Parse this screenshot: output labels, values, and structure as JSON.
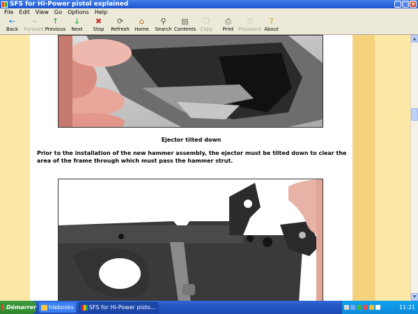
{
  "window": {
    "title": "SFS for Hi-Power pistol explained",
    "min": "_",
    "max": "□",
    "close": "x"
  },
  "menu": [
    "File",
    "Edit",
    "View",
    "Go",
    "Options",
    "Help"
  ],
  "toolbar": [
    {
      "label": "Back",
      "icon": "←",
      "color": "#1a8ad4",
      "enabled": true,
      "name": "back"
    },
    {
      "label": "Forward",
      "icon": "→",
      "color": "#888888",
      "enabled": false,
      "name": "forward"
    },
    {
      "label": "Previous",
      "icon": "↑",
      "color": "#21a121",
      "enabled": true,
      "name": "previous"
    },
    {
      "label": "Next",
      "icon": "↓",
      "color": "#21a121",
      "enabled": true,
      "name": "next"
    },
    {
      "label": "Stop",
      "icon": "✖",
      "color": "#d22a1e",
      "enabled": true,
      "name": "stop"
    },
    {
      "label": "Refresh",
      "icon": "⟳",
      "color": "#555555",
      "enabled": true,
      "name": "refresh"
    },
    {
      "label": "Home",
      "icon": "⌂",
      "color": "#b06a2a",
      "enabled": true,
      "name": "home"
    },
    {
      "label": "Search",
      "icon": "⚲",
      "color": "#444444",
      "enabled": true,
      "name": "search"
    },
    {
      "label": "Contents",
      "icon": "▤",
      "color": "#666666",
      "enabled": true,
      "name": "contents"
    },
    {
      "label": "Copy",
      "icon": "❐",
      "color": "#888888",
      "enabled": false,
      "name": "copy"
    },
    {
      "label": "Print",
      "icon": "⎙",
      "color": "#555555",
      "enabled": true,
      "name": "print"
    },
    {
      "label": "Password",
      "icon": "⚿",
      "color": "#888888",
      "enabled": false,
      "name": "password"
    },
    {
      "label": "About",
      "icon": "?",
      "color": "#c8a000",
      "enabled": true,
      "name": "about"
    }
  ],
  "content": {
    "caption": "Ejector tilted down",
    "paragraph": "Prior to the installation of the new hammer assembly, the ejector must be tilted down to clear the area of the frame through which must pass the hammer strut."
  },
  "taskbar": {
    "start_label": "Démarrer",
    "tasks": [
      {
        "label": "hlebooks",
        "active": false
      },
      {
        "label": "SFS for Hi-Power pisto...",
        "active": true
      }
    ],
    "clock": "11:21"
  }
}
